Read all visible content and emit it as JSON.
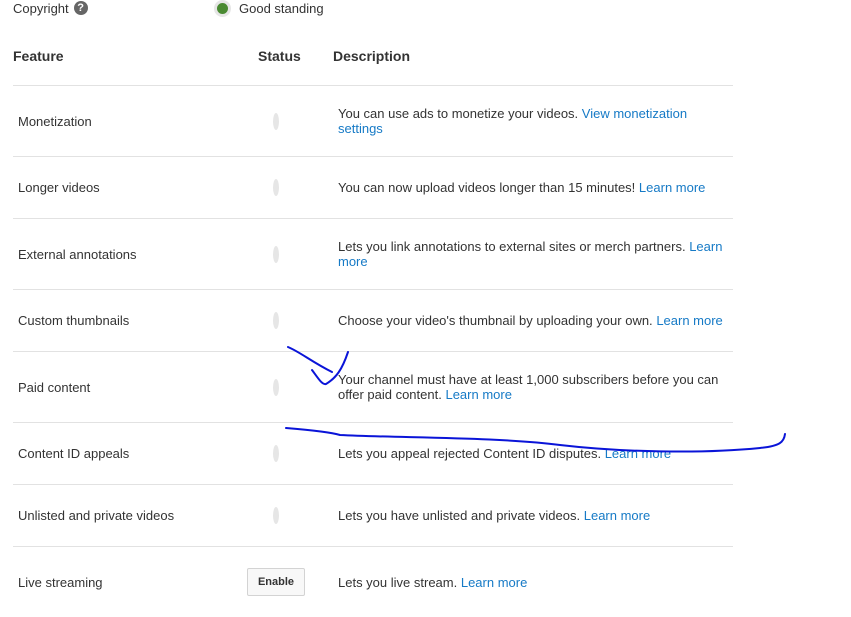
{
  "copyright": {
    "label": "Copyright",
    "help_icon": "question-circle-icon",
    "status": "Good standing",
    "status_color": "#4a8a32"
  },
  "table": {
    "headers": {
      "feature": "Feature",
      "status": "Status",
      "description": "Description"
    },
    "rows": [
      {
        "feature": "Monetization",
        "status": "enabled",
        "description": "You can use ads to monetize your videos.",
        "link": "View monetization settings"
      },
      {
        "feature": "Longer videos",
        "status": "enabled",
        "description": "You can now upload videos longer than 15 minutes!",
        "link": "Learn more"
      },
      {
        "feature": "External annotations",
        "status": "enabled",
        "description": "Lets you link annotations to external sites or merch partners.",
        "link": "Learn more"
      },
      {
        "feature": "Custom thumbnails",
        "status": "enabled",
        "description": "Choose your video's thumbnail by uploading your own.",
        "link": "Learn more"
      },
      {
        "feature": "Paid content",
        "status": "disabled",
        "description": "Your channel must have at least 1,000 subscribers before you can offer paid content.",
        "link": "Learn more"
      },
      {
        "feature": "Content ID appeals",
        "status": "disabled",
        "description": "Lets you appeal rejected Content ID disputes.",
        "link": "Learn more"
      },
      {
        "feature": "Unlisted and private videos",
        "status": "enabled",
        "description": "Lets you have unlisted and private videos.",
        "link": "Learn more"
      },
      {
        "feature": "Live streaming",
        "status": "button",
        "button_label": "Enable",
        "description": "Lets you live stream.",
        "link": "Learn more"
      }
    ]
  },
  "colors": {
    "enabled": "#4a8a32",
    "disabled": "#a9aba6",
    "link": "#167ac6",
    "annotation_ink": "#0a14d8"
  }
}
